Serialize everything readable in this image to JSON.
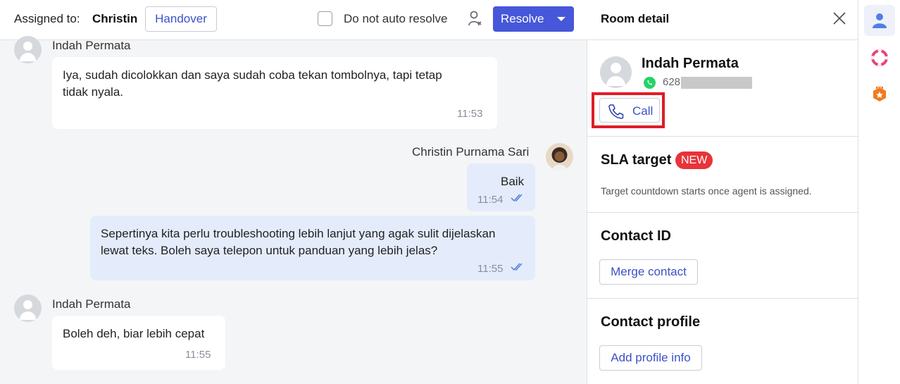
{
  "header": {
    "assigned_label": "Assigned to:",
    "assigned_name": "Christin",
    "handover_label": "Handover",
    "auto_resolve_label": "Do not auto resolve",
    "resolve_label": "Resolve"
  },
  "messages": [
    {
      "sender": "Indah Permata",
      "text_lines": [
        "Iya, sudah dicolokkan dan saya sudah coba tekan tombolnya, tapi tetap",
        "tidak nyala."
      ],
      "time": "11:53",
      "direction": "in"
    },
    {
      "sender": "Christin Purnama Sari",
      "text_lines": [
        "Baik"
      ],
      "time": "11:54",
      "direction": "out",
      "status": "read"
    },
    {
      "sender": "",
      "text_lines": [
        "Sepertinya kita perlu troubleshooting lebih lanjut yang agak sulit dijelaskan",
        "lewat teks. Boleh saya telepon untuk panduan yang lebih jelas?"
      ],
      "time": "11:55",
      "direction": "out",
      "status": "read"
    },
    {
      "sender": "Indah Permata",
      "text_lines": [
        "Boleh deh, biar lebih cepat"
      ],
      "time": "11:55",
      "direction": "in"
    }
  ],
  "detail": {
    "title": "Room detail",
    "contact_name": "Indah Permata",
    "phone_prefix": "628",
    "channel_icon": "whatsapp-icon",
    "call_label": "Call",
    "sla_title": "SLA target",
    "sla_badge": "NEW",
    "sla_desc": "Target countdown starts once agent is assigned.",
    "contact_id_title": "Contact ID",
    "merge_label": "Merge contact",
    "profile_title": "Contact profile",
    "add_profile_label": "Add profile info"
  },
  "rail": {
    "items": [
      {
        "icon": "person-icon",
        "active": true
      },
      {
        "icon": "lifebuoy-icon",
        "active": false
      },
      {
        "icon": "badge-icon",
        "active": false
      }
    ]
  },
  "colors": {
    "accent": "#4657d9",
    "link": "#3b52c9",
    "outgoing_bubble": "#e4ecfc",
    "highlight": "#e01b24",
    "badge_new": "#e8333a",
    "whatsapp": "#25d366"
  }
}
